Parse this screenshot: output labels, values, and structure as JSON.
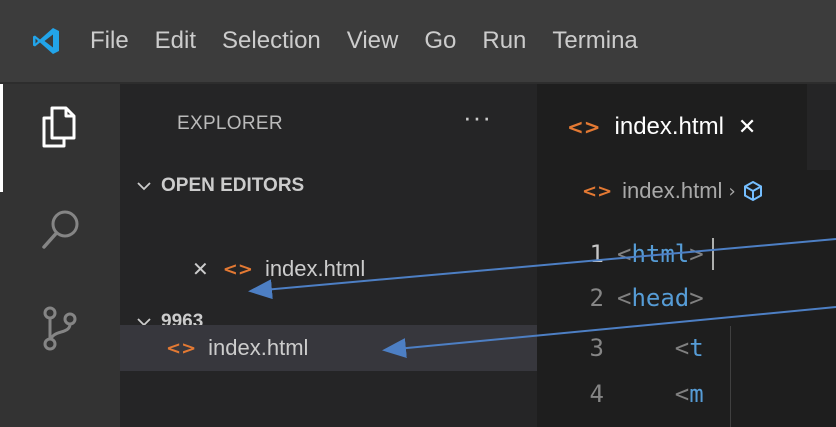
{
  "menubar": {
    "items": [
      "File",
      "Edit",
      "Selection",
      "View",
      "Go",
      "Run",
      "Termina"
    ]
  },
  "activitybar": {
    "icons": [
      "explorer-icon",
      "search-icon",
      "source-control-icon"
    ]
  },
  "sidebar": {
    "title": "EXPLORER",
    "more_label": "···",
    "open_editors": {
      "label": "OPEN EDITORS",
      "close_glyph": "✕",
      "file_glyph": "<>",
      "file_name": "index.html"
    },
    "folder": {
      "label": "9963",
      "file_glyph": "<>",
      "file_name": "index.html"
    }
  },
  "editor": {
    "tab": {
      "glyph": "<>",
      "label": "index.html",
      "close_glyph": "✕"
    },
    "breadcrumb": {
      "glyph": "<>",
      "file": "index.html",
      "separator": "›"
    },
    "lines": [
      {
        "number": "1",
        "indent": "",
        "open": "<",
        "name": "html",
        "close": ">"
      },
      {
        "number": "2",
        "indent": "",
        "open": "<",
        "name": "head",
        "close": ">"
      },
      {
        "number": "3",
        "indent": "    ",
        "open": "<",
        "name": "t",
        "close": ""
      },
      {
        "number": "4",
        "indent": "    ",
        "open": "<",
        "name": "m",
        "close": ""
      }
    ]
  },
  "colors": {
    "menubar_bg": "#3c3c3c",
    "activitybar_bg": "#333333",
    "sidebar_bg": "#252526",
    "editor_bg": "#1e1e1e",
    "html_icon": "#e37933",
    "tag": "#569cd6",
    "vscode_blue": "#22a4e9",
    "arrow": "#4d7fc4"
  }
}
